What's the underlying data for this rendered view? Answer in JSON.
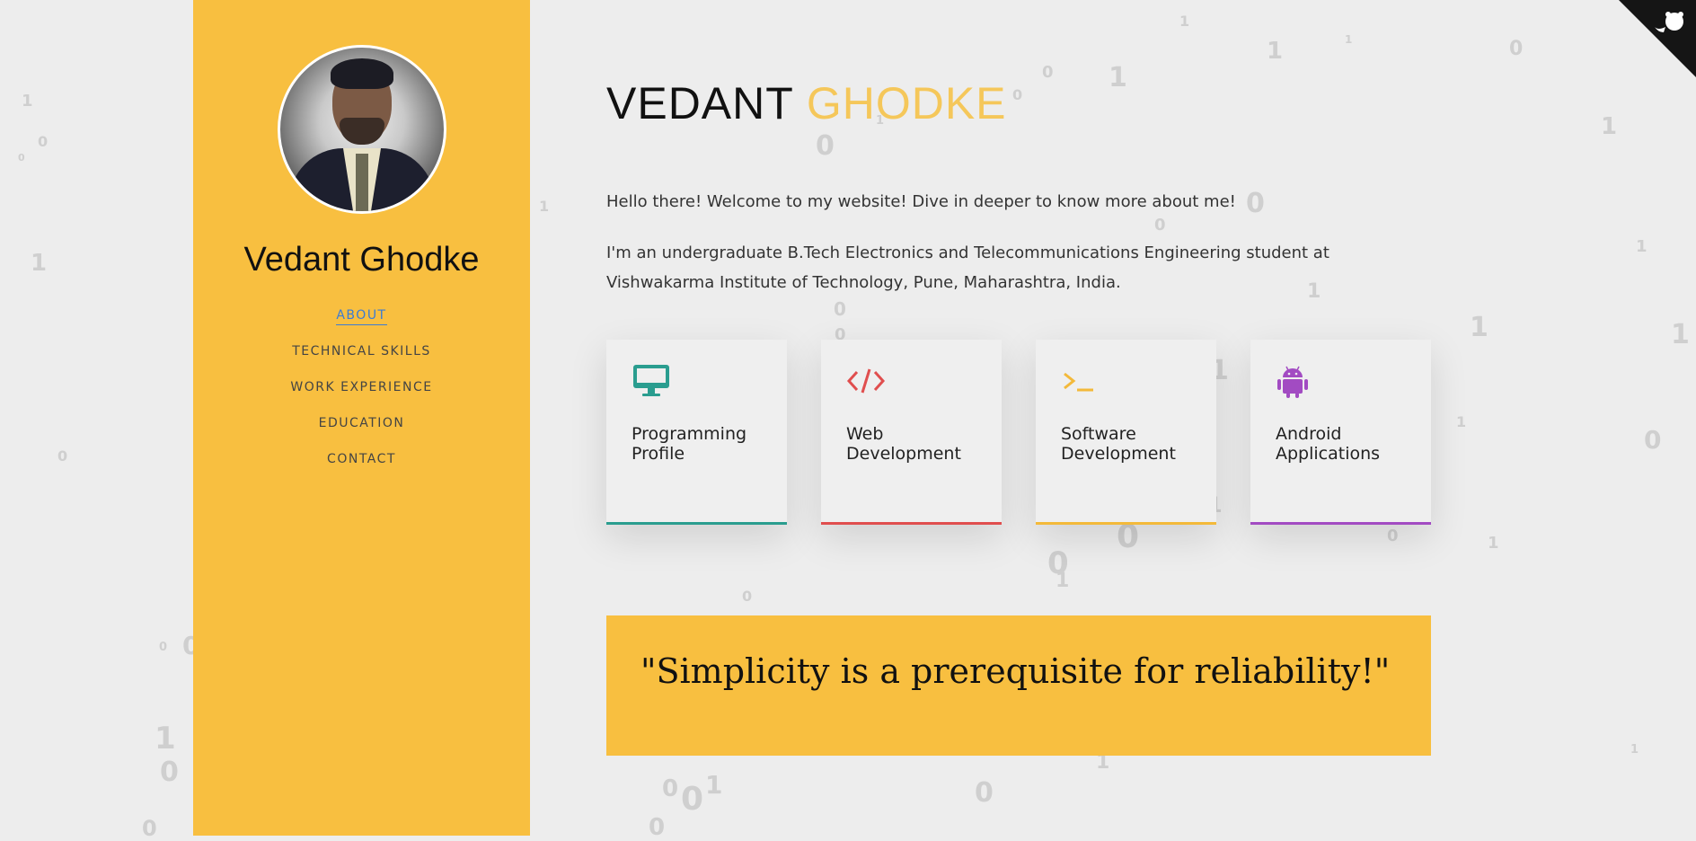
{
  "colors": {
    "sidebar_bg": "#f8bf40",
    "page_bg": "#ededed",
    "accent_blue": "#3a7bd5",
    "title_highlight": "#f5c75a",
    "teal": "#2a9d8f",
    "red": "#e04e4e",
    "yellow": "#f3b93a",
    "purple": "#a24bc2"
  },
  "sidebar": {
    "avatar_alt": "profile-photo",
    "name": "Vedant Ghodke",
    "nav": [
      {
        "label": "ABOUT",
        "active": true
      },
      {
        "label": "TECHNICAL SKILLS",
        "active": false
      },
      {
        "label": "WORK EXPERIENCE",
        "active": false
      },
      {
        "label": "EDUCATION",
        "active": false
      },
      {
        "label": "CONTACT",
        "active": false
      }
    ]
  },
  "main": {
    "title_first": "VEDANT",
    "title_last": "GHODKE",
    "intro": "Hello there! Welcome to my website! Dive in deeper to know more about me!",
    "bio": "I'm an undergraduate B.Tech Electronics and Telecommunications Engineering student at Vishwakarma Institute of Technology, Pune, Maharashtra, India.",
    "cards": [
      {
        "label": "Programming Profile",
        "icon": "monitor-icon",
        "color": "#2a9d8f"
      },
      {
        "label": "Web Development",
        "icon": "code-icon",
        "color": "#e04e4e"
      },
      {
        "label": "Software Development",
        "icon": "terminal-icon",
        "color": "#f3b93a"
      },
      {
        "label": "Android Applications",
        "icon": "android-icon",
        "color": "#a24bc2"
      }
    ],
    "quote": "\"Simplicity is a prerequisite for reliability!\""
  },
  "corner": {
    "icon": "github-corner-icon"
  }
}
